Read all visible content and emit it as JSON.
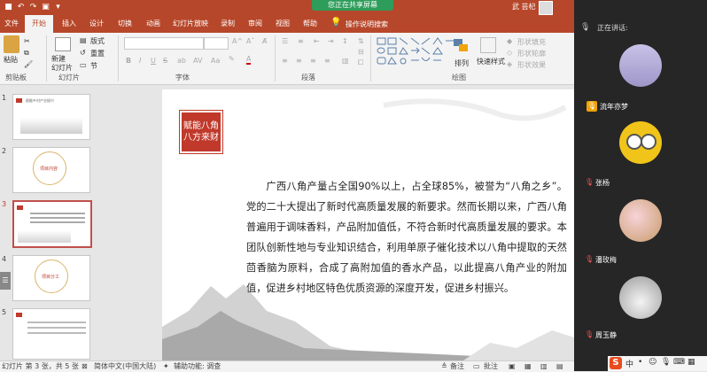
{
  "titlebar": {
    "share_label": "您正在共享屏幕",
    "user_name": "武 芸杞"
  },
  "tabs": [
    "文件",
    "开始",
    "插入",
    "设计",
    "切换",
    "动画",
    "幻灯片放映",
    "录制",
    "审阅",
    "视图",
    "帮助"
  ],
  "tell_me": "操作说明搜索",
  "ribbon": {
    "paste": "粘贴",
    "new_slide": "新建\n幻灯片",
    "layout": "版式",
    "reset": "重置",
    "section": "节",
    "font_bold": "B",
    "font_italic": "I",
    "font_underline": "U",
    "font_strike": "S",
    "font_a": "A",
    "arrange": "排列",
    "quick_styles": "快速样式",
    "shape_fill": "形状填充",
    "shape_outline": "形状轮廓",
    "shape_effects": "形状效果",
    "groups": {
      "clipboard": "剪贴板",
      "slides": "幻灯片",
      "font": "字体",
      "paragraph": "段落",
      "drawing": "绘图"
    }
  },
  "thumbnails": [
    {
      "num": "1",
      "text": "赋能乡村产业振兴"
    },
    {
      "num": "2",
      "text": "项目内容"
    },
    {
      "num": "3",
      "text": ""
    },
    {
      "num": "4",
      "text": "项目分工"
    },
    {
      "num": "5",
      "text": ""
    }
  ],
  "slide": {
    "stamp": "赋能八角\n八方来财",
    "body": "广西八角产量占全国90%以上，占全球85%，被誉为“八角之乡”。党的二十大提出了新时代高质量发展的新要求。然而长期以来，广西八角普遍用于调味香料，产品附加值低，不符合新时代高质量发展的要求。本团队创新性地与专业知识结合，利用单原子催化技术以八角中提取的天然茴香脑为原料，合成了高附加值的香水产品，以此提高八角产业的附加值，促进乡村地区特色优质资源的深度开发，促进乡村振兴。"
  },
  "statusbar": {
    "slide_info": "幻灯片 第 3 张，共 5 张",
    "language": "简体中文(中国大陆)",
    "accessibility": "辅助功能: 调查",
    "notes": "备注",
    "comments": "批注"
  },
  "video_panel": {
    "speaking_label": "正在讲话:",
    "participants": [
      {
        "name": "流年亦梦",
        "color": "#b9b3d6"
      },
      {
        "name": "张杨",
        "color": "#f0c419"
      },
      {
        "name": "潘玫梅",
        "color": "#d8b88a"
      },
      {
        "name": "周玉静",
        "color": "#c8c8c8"
      }
    ]
  },
  "colors": {
    "ppt_brand": "#b7472a",
    "share_green": "#2e9c5a",
    "stamp_red": "#c0392b",
    "speaker_orange": "#f0a30a"
  }
}
